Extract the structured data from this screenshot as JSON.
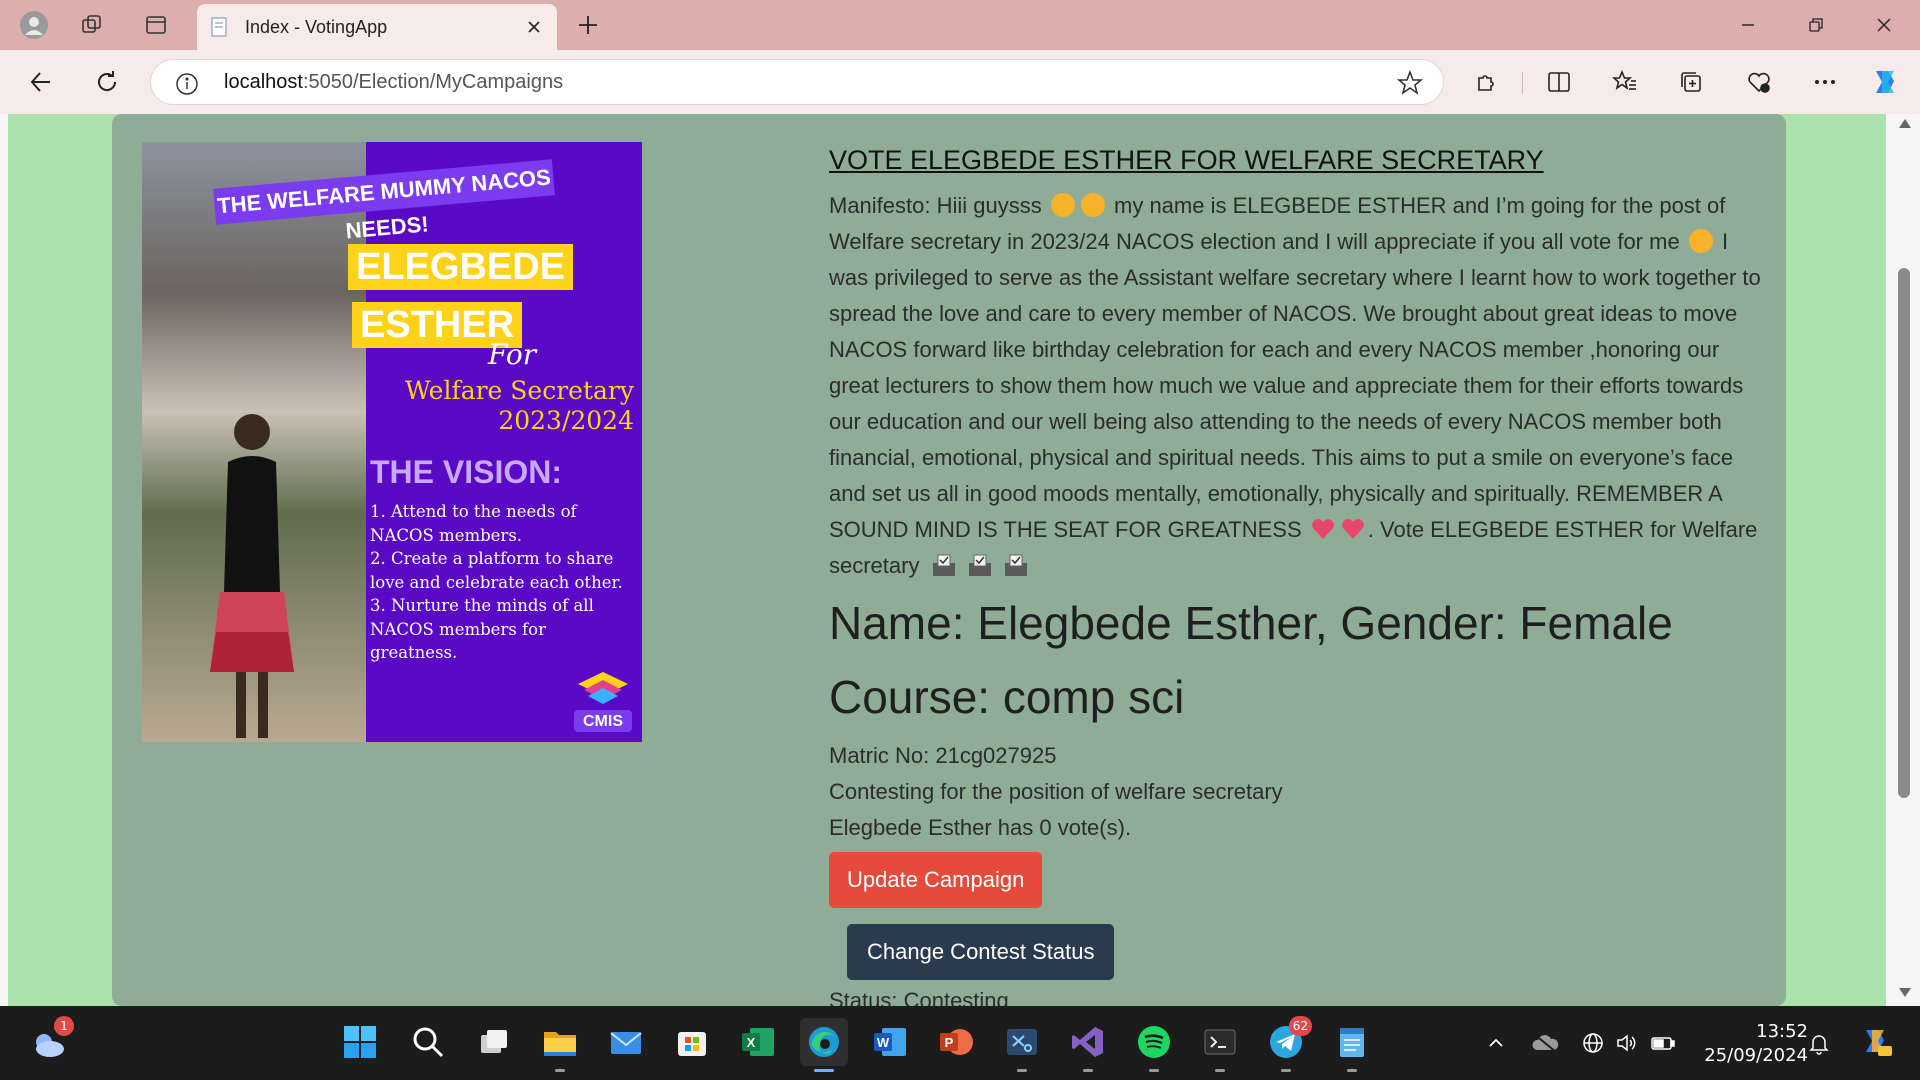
{
  "browser": {
    "tab_title": "Index - VotingApp",
    "url_host": "localhost",
    "url_path": ":5050/Election/MyCampaigns"
  },
  "poster": {
    "banner": "THE WELFARE MUMMY NACOS NEEDS!",
    "first_name": "ELEGBEDE",
    "last_name": "ESTHER",
    "for": "For",
    "role": "Welfare Secretary",
    "year": "2023/2024",
    "vision_heading": "THE VISION:",
    "vision_items": [
      "1. Attend to the needs of NACOS members.",
      "2. Create a platform to share love and celebrate each other.",
      "3. Nurture the minds of all NACOS members for greatness."
    ],
    "logo_text": "CMIS"
  },
  "campaign": {
    "title": "VOTE ELEGBEDE ESTHER FOR WELFARE SECRETARY",
    "manifesto_part1": "Manifesto: Hiii guysss",
    "manifesto_part2": "my name is ELEGBEDE ESTHER and I’m going for the post of Welfare secretary in 2023/24 NACOS election and I will appreciate if you all vote for me",
    "manifesto_part3": "I was privileged to serve as the Assistant welfare secretary where I learnt how to work together to spread the love and care to every member of NACOS. We brought about great ideas to move NACOS forward like birthday celebration for each and every NACOS member ,honoring our great lecturers to show them how much we value and appreciate them for their efforts towards our education and our well being also attending to the needs of every NACOS member both financial, emotional, physical and spiritual needs. This aims to put a smile on everyone’s face and set us all in good moods mentally, emotionally, physically and spiritually. REMEMBER A SOUND MIND IS THE SEAT FOR GREATNESS",
    "manifesto_part4": ". Vote ELEGBEDE ESTHER for Welfare secretary",
    "name_gender": "Name: Elegbede Esther, Gender: Female",
    "course": "Course: comp sci",
    "matric": "Matric No: 21cg027925",
    "position": "Contesting for the position of welfare secretary",
    "votes": "Elegbede Esther has 0 vote(s).",
    "update_button": "Update Campaign",
    "status_button": "Change Contest Status",
    "status": "Status: Contesting"
  },
  "taskbar": {
    "weather_badge": "1",
    "telegram_badge": "62",
    "time": "13:52",
    "date": "25/09/2024"
  },
  "colors": {
    "page_green": "#ace3ac",
    "card": "#8fac97",
    "update_button": "#e64a3b",
    "status_button": "#2a3b4f",
    "poster_purple": "#5a0ac4",
    "poster_yellow": "#ffd21a"
  }
}
